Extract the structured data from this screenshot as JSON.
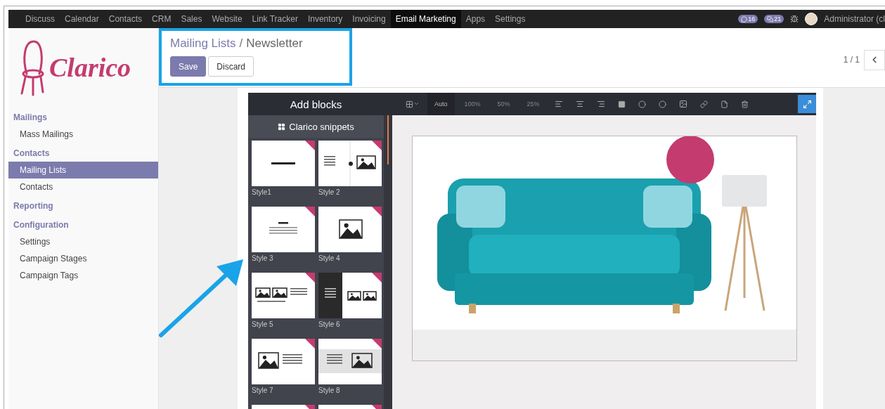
{
  "top_menu": {
    "items": [
      {
        "label": "Discuss",
        "selected": false
      },
      {
        "label": "Calendar",
        "selected": false
      },
      {
        "label": "Contacts",
        "selected": false
      },
      {
        "label": "CRM",
        "selected": false
      },
      {
        "label": "Sales",
        "selected": false
      },
      {
        "label": "Website",
        "selected": false
      },
      {
        "label": "Link Tracker",
        "selected": false
      },
      {
        "label": "Inventory",
        "selected": false
      },
      {
        "label": "Invoicing",
        "selected": false
      },
      {
        "label": "Email Marketing",
        "selected": true
      },
      {
        "label": "Apps",
        "selected": false
      },
      {
        "label": "Settings",
        "selected": false
      }
    ],
    "badges": [
      {
        "kind": "chat",
        "count": "16"
      },
      {
        "kind": "messages",
        "count": "21"
      }
    ],
    "user": "Administrator (cl"
  },
  "sidebar": {
    "logo": "Clarico",
    "sections": [
      {
        "title": "Mailings",
        "items": [
          {
            "label": "Mass Mailings",
            "selected": false
          }
        ]
      },
      {
        "title": "Contacts",
        "items": [
          {
            "label": "Mailing Lists",
            "selected": true
          },
          {
            "label": "Contacts",
            "selected": false
          }
        ]
      },
      {
        "title": "Reporting"
      },
      {
        "title": "Configuration",
        "items": [
          {
            "label": "Settings",
            "selected": false
          },
          {
            "label": "Campaign Stages",
            "selected": false
          },
          {
            "label": "Campaign Tags",
            "selected": false
          }
        ]
      }
    ]
  },
  "breadcrumb": {
    "parent": "Mailing Lists",
    "separator": "/",
    "current": "Newsletter"
  },
  "buttons": [
    {
      "label": "Save",
      "kind": "primary"
    },
    {
      "label": "Discard",
      "kind": "secondary"
    }
  ],
  "pager": {
    "text": "1 / 1"
  },
  "editor": {
    "panel_title": "Add blocks",
    "snippet_group": "Clarico snippets",
    "snippets": [
      {
        "label": "Style1",
        "kind": "divider"
      },
      {
        "label": "Style 2",
        "kind": "text-image"
      },
      {
        "label": "Style 3",
        "kind": "title-text"
      },
      {
        "label": "Style 4",
        "kind": "image"
      },
      {
        "label": "Style 5",
        "kind": "gallery-text"
      },
      {
        "label": "Style 6",
        "kind": "dark-gallery"
      },
      {
        "label": "Style 7",
        "kind": "image-text"
      },
      {
        "label": "Style 8",
        "kind": "band"
      },
      {
        "kind": "blank"
      },
      {
        "kind": "blank"
      }
    ],
    "toolbar": {
      "sizes": [
        {
          "label": "Auto",
          "selected": true
        },
        {
          "label": "100%",
          "selected": false
        },
        {
          "label": "50%",
          "selected": false
        },
        {
          "label": "25%",
          "selected": false
        }
      ]
    }
  }
}
